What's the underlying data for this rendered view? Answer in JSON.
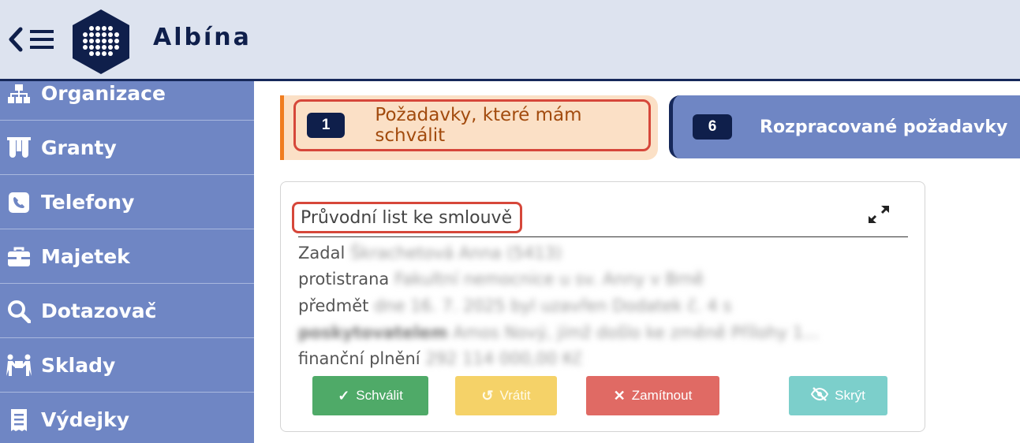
{
  "app": {
    "brand": "Albína"
  },
  "sidebar": {
    "items": [
      {
        "label": "Organizace",
        "icon": "sitemap-icon"
      },
      {
        "label": "Granty",
        "icon": "flask-icon"
      },
      {
        "label": "Telefony",
        "icon": "phone-icon"
      },
      {
        "label": "Majetek",
        "icon": "briefcase-icon"
      },
      {
        "label": "Dotazovač",
        "icon": "search-icon"
      },
      {
        "label": "Sklady",
        "icon": "people-carry-icon"
      },
      {
        "label": "Výdejky",
        "icon": "receipt-icon"
      }
    ]
  },
  "tabs": [
    {
      "count": "1",
      "label": "Požadavky, které mám schválit",
      "active": true
    },
    {
      "count": "6",
      "label": "Rozpracované požadavky",
      "active": false
    }
  ],
  "card": {
    "title": "Průvodní list ke smlouvě",
    "fields": {
      "zadal_label": "Zadal",
      "zadal_value": "Škrachetová Anna (5413)",
      "protistrana_label": "protistrana",
      "protistrana_value": "Fakultní nemocnice u sv. Anny v Brně",
      "predmet_label": "předmět",
      "predmet_value_1": "dne 16. 7. 2025 byl uzavřen Dodatek č. 4 s",
      "predmet_value_2_bold": "poskytovatelem",
      "predmet_value_2": "Amos Nový, jímž došlo ke změně Přílohy 1...",
      "financni_label": "finanční plnění",
      "financni_value": "292 114 000,00 Kč"
    }
  },
  "actions": {
    "approve": "Schválit",
    "return": "Vrátit",
    "reject": "Zamítnout",
    "hide": "Skrýt"
  },
  "colors": {
    "navy": "#0f1f4b",
    "sidebar": "#6f86c4",
    "active_tab_bg": "#fbe0c6",
    "active_tab_accent": "#f07c1f",
    "highlight": "#d6473a",
    "approve": "#4faa68",
    "return": "#f5d268",
    "reject": "#e06a64",
    "hide": "#7ccfcb"
  }
}
